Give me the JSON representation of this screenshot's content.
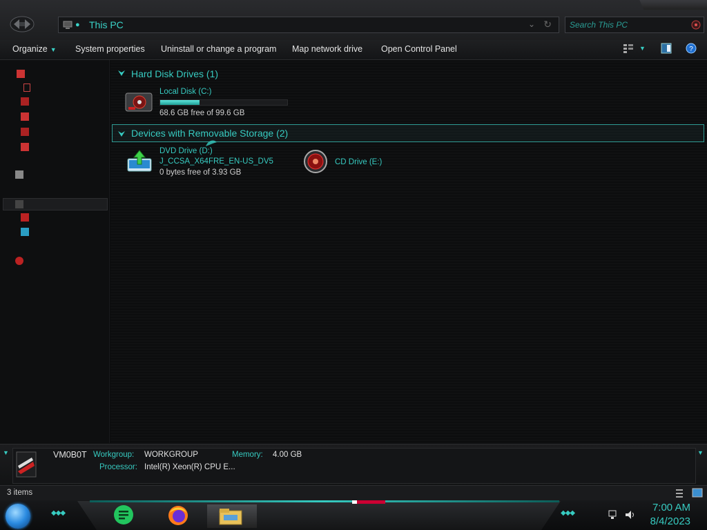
{
  "address": {
    "location": "This PC"
  },
  "search": {
    "placeholder": "Search This PC"
  },
  "toolbar": {
    "organize": "Organize",
    "system_properties": "System properties",
    "uninstall": "Uninstall or change a program",
    "map_network": "Map network drive",
    "control_panel": "Open Control Panel"
  },
  "groups": {
    "hard_disks": {
      "title": "Hard Disk Drives (1)"
    },
    "removable": {
      "title": "Devices with Removable Storage (2)"
    }
  },
  "drives": {
    "local_c": {
      "name": "Local Disk (C:)",
      "free": "68.6 GB free of 99.6 GB",
      "used_fraction": 0.31
    },
    "dvd_d": {
      "name": "DVD Drive (D:)",
      "label": "J_CCSA_X64FRE_EN-US_DV5",
      "free": "0 bytes free of 3.93 GB"
    },
    "cd_e": {
      "name": "CD Drive (E:)"
    }
  },
  "details": {
    "computer_name": "VM0B0T",
    "workgroup_label": "Workgroup:",
    "workgroup_value": "WORKGROUP",
    "memory_label": "Memory:",
    "memory_value": "4.00 GB",
    "processor_label": "Processor:",
    "processor_value": "Intel(R) Xeon(R) CPU E..."
  },
  "status": {
    "items": "3 items"
  },
  "clock": {
    "time": "7:00 AM",
    "date": "8/4/2023"
  },
  "colors": {
    "accent": "#37cbc1",
    "background": "#0c0d0e"
  }
}
